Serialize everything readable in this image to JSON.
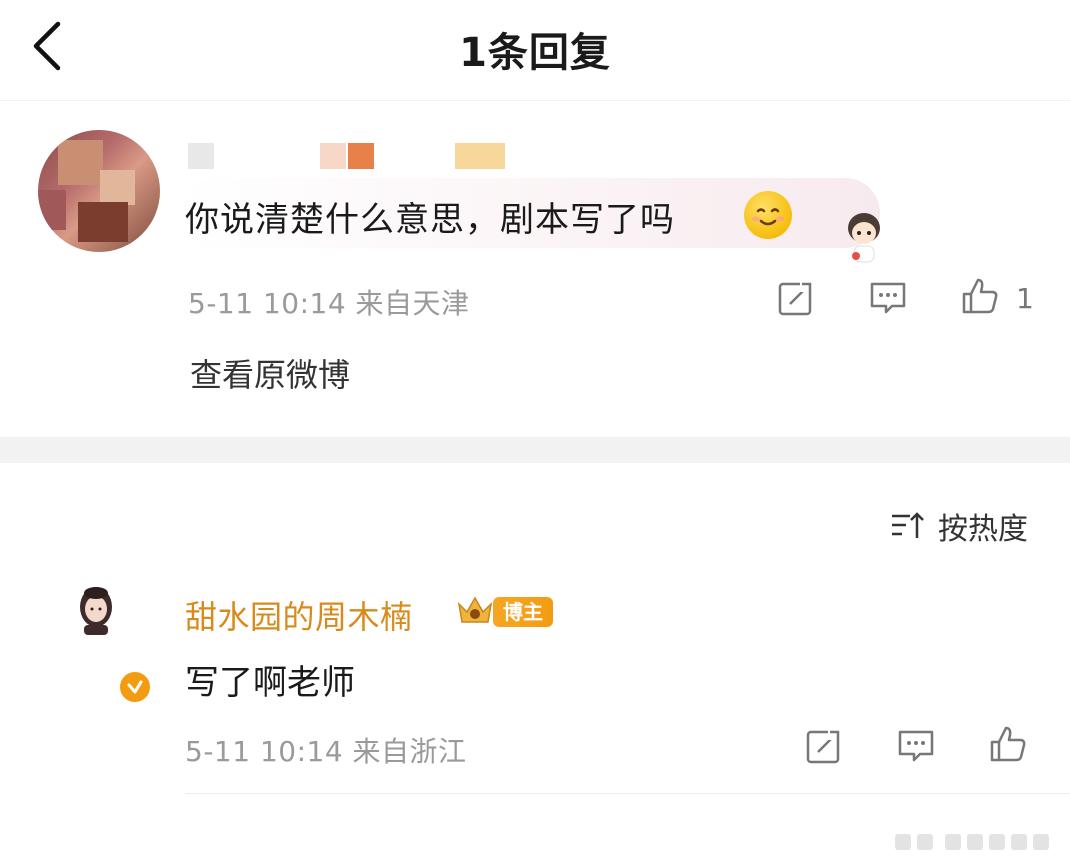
{
  "header": {
    "title": "1条回复"
  },
  "original_comment": {
    "text": "你说清楚什么意思，剧本写了吗",
    "meta": "5-11 10:14  来自天津",
    "like_count": "1",
    "view_original_label": "查看原微博"
  },
  "sort": {
    "label": "按热度"
  },
  "reply": {
    "username": "甜水园的周木楠",
    "badge": "博主",
    "text": "写了啊老师",
    "meta": "5-11 10:14  来自浙江"
  },
  "colors": {
    "username": "#d88b1c",
    "badge_bg": "#f39c12",
    "meta_text": "#9a9a9a"
  },
  "icons": [
    "back-icon",
    "repost-icon",
    "comment-icon",
    "like-icon",
    "sort-icon",
    "verified-icon",
    "crown-icon",
    "smile-emoji-icon"
  ]
}
